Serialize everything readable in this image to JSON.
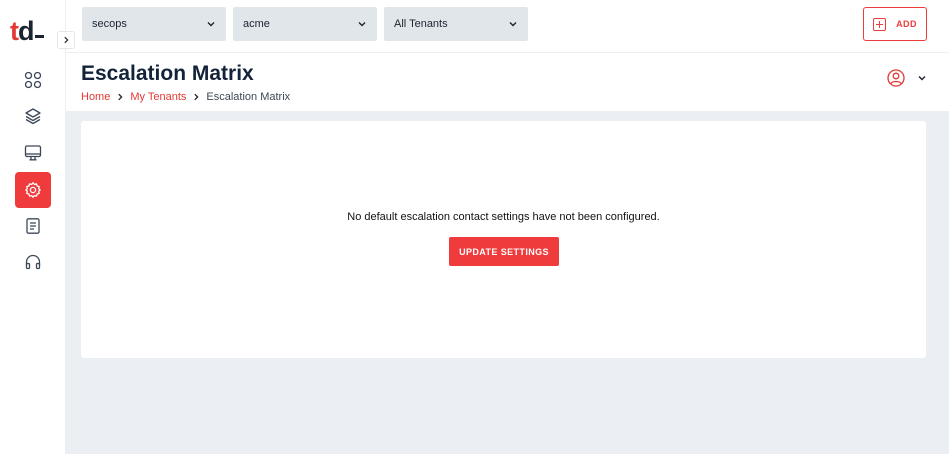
{
  "logo": {
    "t": "t",
    "d": "d"
  },
  "sidebar": {
    "items": [
      {
        "name": "dashboard",
        "icon": "grid-icon"
      },
      {
        "name": "layers",
        "icon": "layers-icon"
      },
      {
        "name": "monitor",
        "icon": "monitor-icon"
      },
      {
        "name": "settings",
        "icon": "gear-icon",
        "active": true
      },
      {
        "name": "reports",
        "icon": "document-icon"
      },
      {
        "name": "support",
        "icon": "headphones-icon"
      }
    ]
  },
  "topbar": {
    "selects": [
      {
        "value": "secops"
      },
      {
        "value": "acme"
      },
      {
        "value": "All Tenants"
      }
    ],
    "add_label": "ADD"
  },
  "header": {
    "title": "Escalation Matrix",
    "breadcrumb": [
      {
        "label": "Home"
      },
      {
        "label": "My Tenants"
      },
      {
        "label": "Escalation Matrix"
      }
    ]
  },
  "main": {
    "empty_message": "No default escalation contact settings have not been configured.",
    "update_label": "UPDATE SETTINGS"
  },
  "colors": {
    "accent": "#ef3b3b",
    "title": "#13233a",
    "content_bg": "#ebeef2",
    "select_bg": "#e1e6eb"
  }
}
